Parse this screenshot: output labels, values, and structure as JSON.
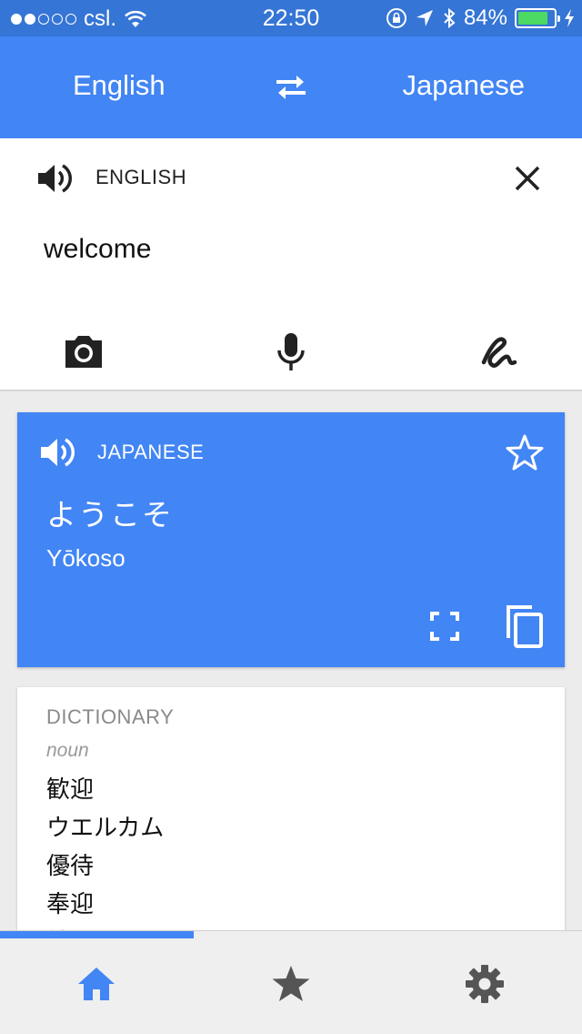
{
  "status_bar": {
    "carrier": "csl.",
    "time": "22:50",
    "battery": "84%",
    "battery_level": 0.84
  },
  "lang_bar": {
    "source": "English",
    "target": "Japanese"
  },
  "input": {
    "language_label": "ENGLISH",
    "text": "welcome"
  },
  "result": {
    "language_label": "JAPANESE",
    "text": "ようこそ",
    "transliteration": "Yōkoso"
  },
  "dictionary": {
    "title": "DICTIONARY",
    "part_of_speech": "noun",
    "entries": [
      "歓迎",
      "ウエルカム",
      "優待",
      "奉迎",
      "請見"
    ]
  },
  "nav": {
    "items": [
      "home-icon",
      "star-icon",
      "gear-icon"
    ],
    "active": 0
  },
  "colors": {
    "primary": "#4285f4",
    "status_bar": "#3575d6",
    "battery_fill": "#4cd964"
  }
}
